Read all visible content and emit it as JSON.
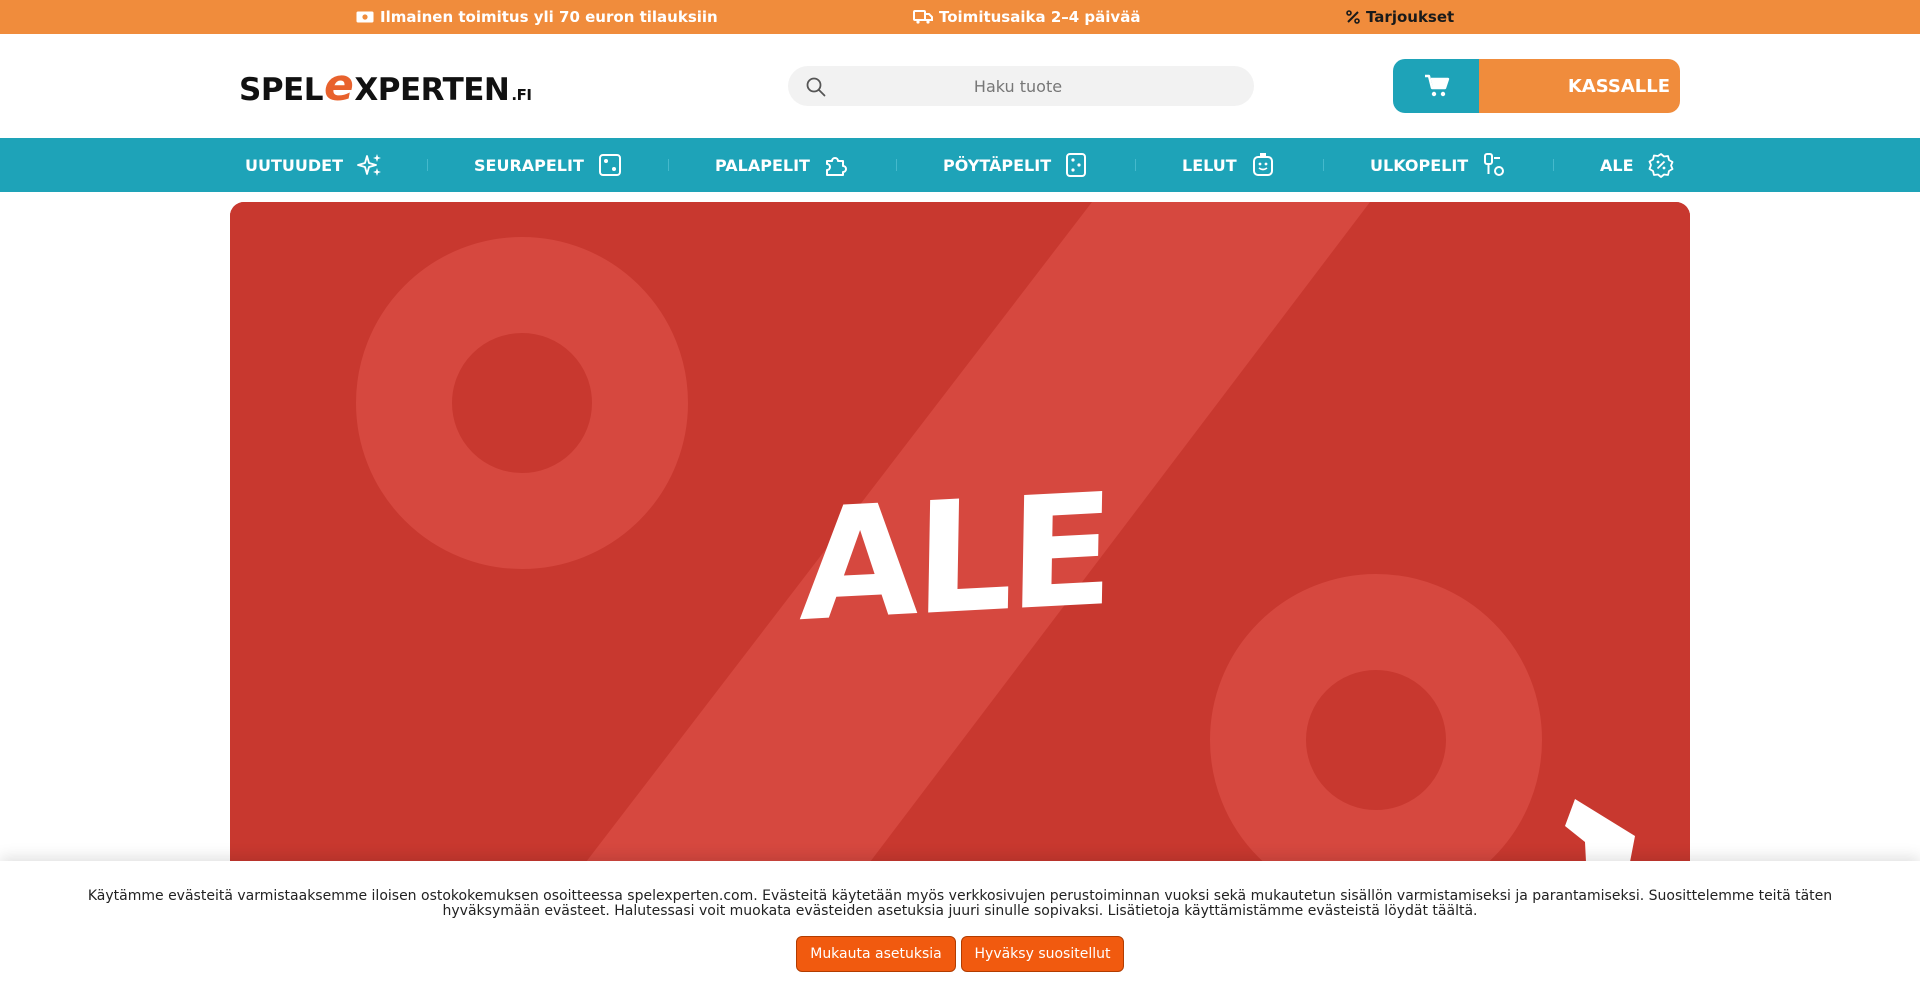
{
  "topbar": {
    "shipping": "Ilmainen toimitus yli 70 euron tilauksiin",
    "delivery": "Toimitusaika 2–4 päivää",
    "offers": "Tarjoukset",
    "background": "#f08c3c"
  },
  "header": {
    "logo": {
      "part1": "SPEL",
      "part2": "e",
      "part3": "XPERTEN",
      "part4": ".FI"
    },
    "search_placeholder": "Haku tuote",
    "checkout_label": "KASSALLE"
  },
  "nav": {
    "background": "#1ea3b8",
    "items": [
      {
        "label": "UUTUUDET",
        "icon": "sparkles-icon"
      },
      {
        "label": "SEURAPELIT",
        "icon": "dice-icon"
      },
      {
        "label": "PALAPELIT",
        "icon": "puzzle-icon"
      },
      {
        "label": "PÖYTÄPELIT",
        "icon": "board-game-icon"
      },
      {
        "label": "LELUT",
        "icon": "toy-icon"
      },
      {
        "label": "ULKOPELIT",
        "icon": "outdoor-game-icon"
      },
      {
        "label": "ALE",
        "icon": "discount-badge-icon"
      }
    ]
  },
  "banner": {
    "title": "ALE",
    "background": "#c8382f",
    "accent": "#d6483f"
  },
  "cookie": {
    "text": "Käytämme evästeitä varmistaaksemme iloisen ostokokemuksen osoitteessa spelexperten.com. Evästeitä käytetään myös verkkosivujen perustoiminnan vuoksi sekä mukautetun sisällön varmistamiseksi ja parantamiseksi. Suosittelemme teitä täten hyväksymään evästeet. Halutessasi voit muokata evästeiden asetuksia juuri sinulle sopivaksi. Lisätietoja käyttämistämme evästeistä löydät täältä.",
    "customize_label": "Mukauta asetuksia",
    "accept_label": "Hyväksy suositellut",
    "button_color": "#f15a0f"
  }
}
